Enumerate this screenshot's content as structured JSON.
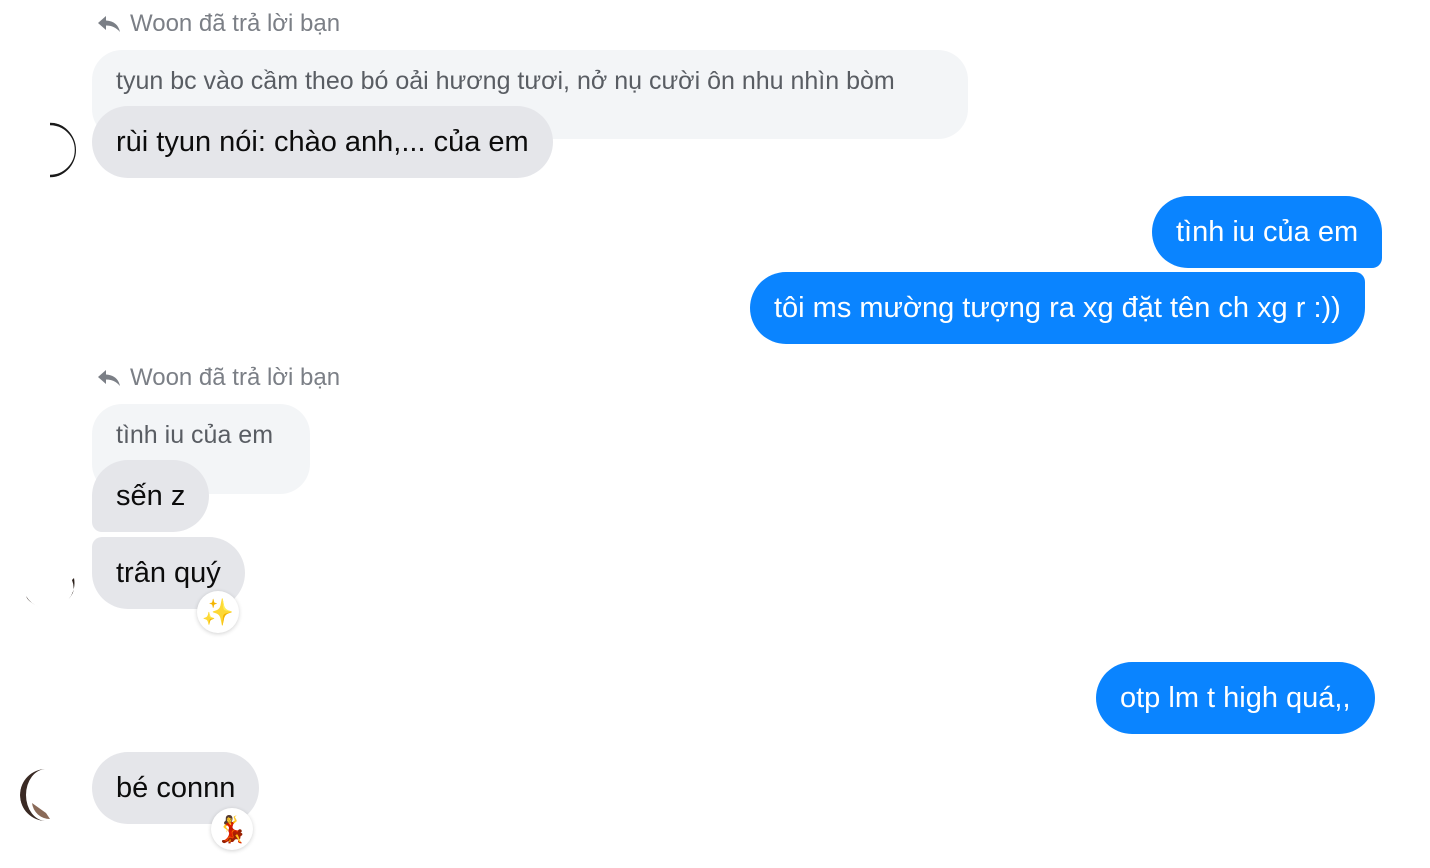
{
  "messages": {
    "reply1": {
      "note": "Woon đã trả lời bạn",
      "quoted": "tyun bc vào cầm theo bó oải hương tươi, nở nụ cười ôn nhu nhìn bòm",
      "text": "rùi tyun nói: chào anh,... của em"
    },
    "out1": [
      "tình iu của em",
      "tôi ms mường tượng ra xg đặt tên ch xg r :))"
    ],
    "reply2": {
      "note": "Woon đã trả lời bạn",
      "quoted": "tình iu của em",
      "texts": [
        "sến z",
        "trân quý"
      ],
      "reaction": "✨"
    },
    "out2": "otp lm t high quá,,",
    "last": {
      "text": "bé connn",
      "reaction": "💃"
    }
  },
  "colors": {
    "outgoing": "#0a84ff",
    "incoming": "#e5e6ea",
    "quoted": "#f3f5f7"
  }
}
